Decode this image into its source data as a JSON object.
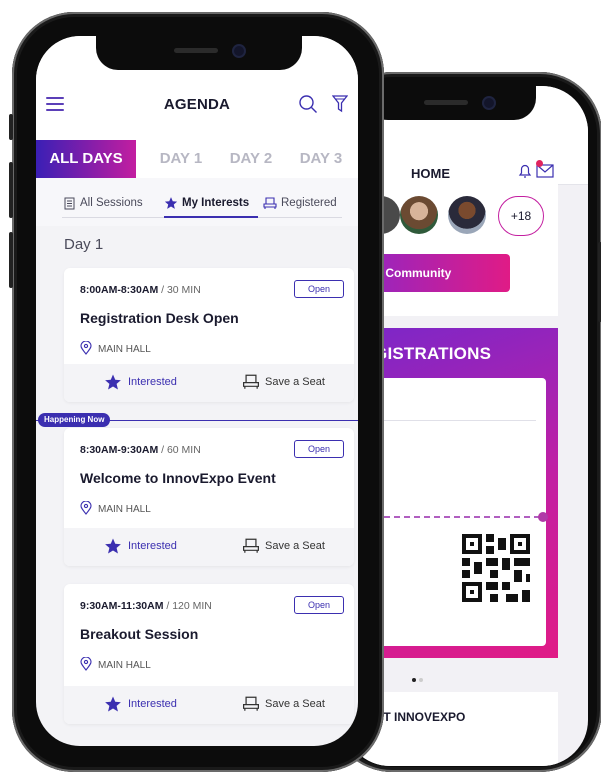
{
  "front": {
    "header": {
      "title": "AGENDA"
    },
    "day_tabs": [
      "ALL DAYS",
      "DAY 1",
      "DAY 2",
      "DAY 3"
    ],
    "sub_tabs": [
      "All Sessions",
      "My Interests",
      "Registered"
    ],
    "day_heading": "Day 1",
    "happening_now": "Happening Now",
    "sessions": [
      {
        "time": "8:00AM-8:30AM",
        "duration": "/ 30 MIN",
        "status": "Open",
        "title": "Registration Desk Open",
        "location": "MAIN HALL",
        "interested": "Interested",
        "save": "Save a Seat"
      },
      {
        "time": "8:30AM-9:30AM",
        "duration": "/ 60 MIN",
        "status": "Open",
        "title": "Welcome to InnovExpo Event",
        "location": "MAIN HALL",
        "interested": "Interested",
        "save": "Save a Seat"
      },
      {
        "time": "9:30AM-11:30AM",
        "duration": "/ 120 MIN",
        "status": "Open",
        "title": "Breakout Session",
        "location": "MAIN HALL",
        "interested": "Interested",
        "save": "Save a Seat"
      }
    ]
  },
  "back": {
    "header": {
      "title": "HOME"
    },
    "community": {
      "more_count": "+18",
      "button": "in the Community"
    },
    "registrations": {
      "title": "REGISTRATIONS"
    },
    "about": {
      "title": "ABOUT INNOVEXPO"
    }
  },
  "colors": {
    "accent": "#3b2fb0",
    "gradient_start": "#3a1fb5",
    "gradient_end": "#e01b86"
  }
}
